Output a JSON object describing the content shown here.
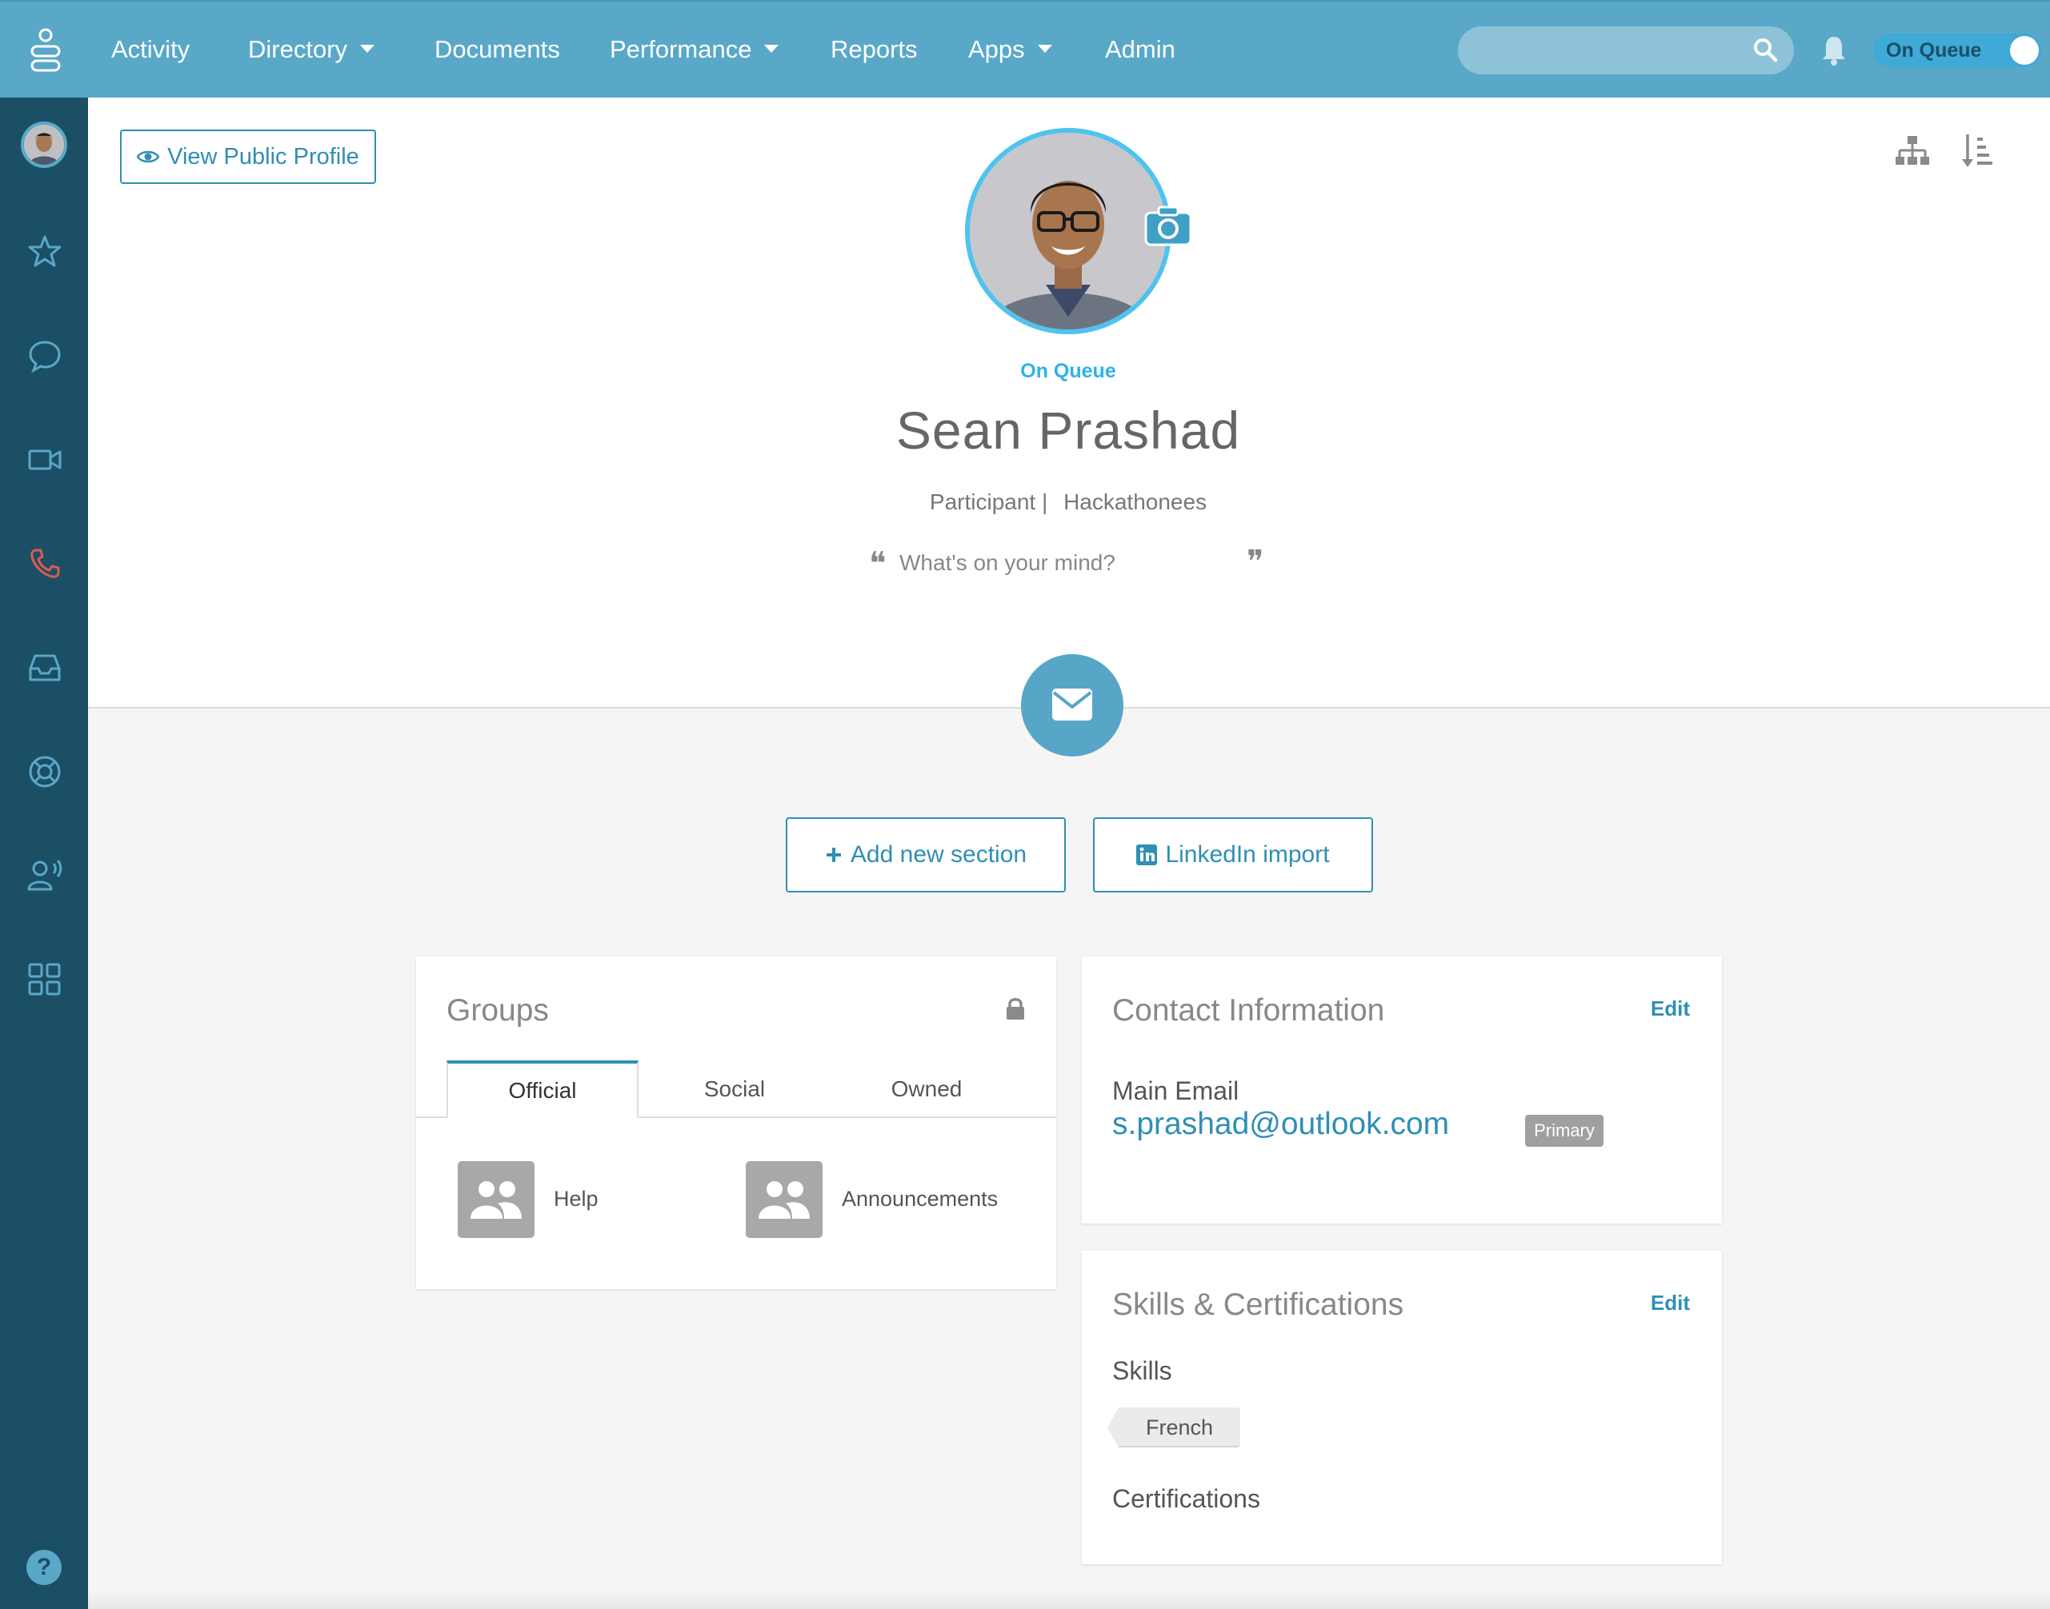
{
  "nav": {
    "items": [
      {
        "label": "Activity",
        "dropdown": false
      },
      {
        "label": "Directory",
        "dropdown": true
      },
      {
        "label": "Documents",
        "dropdown": false
      },
      {
        "label": "Performance",
        "dropdown": true
      },
      {
        "label": "Reports",
        "dropdown": false
      },
      {
        "label": "Apps",
        "dropdown": true
      },
      {
        "label": "Admin",
        "dropdown": false
      }
    ],
    "search_value": "",
    "queue_toggle_label": "On Queue",
    "queue_toggle_on": true
  },
  "sidebar": {
    "icons": [
      "favorites-star-icon",
      "chat-icon",
      "video-icon",
      "phone-icon",
      "inbox-icon",
      "support-icon",
      "presence-icon",
      "apps-icon"
    ],
    "help_label": "?"
  },
  "profile": {
    "view_public_label": "View Public Profile",
    "status": "On Queue",
    "name": "Sean Prashad",
    "title": "Participant",
    "department": "Hackathonees",
    "separator": "|",
    "mind_placeholder": "What's on your mind?",
    "quote_open": "❝",
    "quote_close": "❞"
  },
  "actions": {
    "add_section_label": "Add new section",
    "linkedin_label": "LinkedIn import"
  },
  "groups": {
    "title": "Groups",
    "tabs": [
      "Official",
      "Social",
      "Owned"
    ],
    "active_tab": "Official",
    "items": [
      {
        "label": "Help"
      },
      {
        "label": "Announcements"
      }
    ]
  },
  "contact": {
    "title": "Contact Information",
    "edit_label": "Edit",
    "email_label": "Main Email",
    "email": "s.prashad@outlook.com",
    "badge": "Primary"
  },
  "skills": {
    "title": "Skills & Certifications",
    "edit_label": "Edit",
    "skills_label": "Skills",
    "skills": [
      "French"
    ],
    "certifications_label": "Certifications"
  },
  "colors": {
    "topbar": "#5aa8c8",
    "sidebar": "#1b4f66",
    "accent": "#2f8fb4",
    "status": "#2eb3e6",
    "phone_icon": "#e05a4f"
  }
}
